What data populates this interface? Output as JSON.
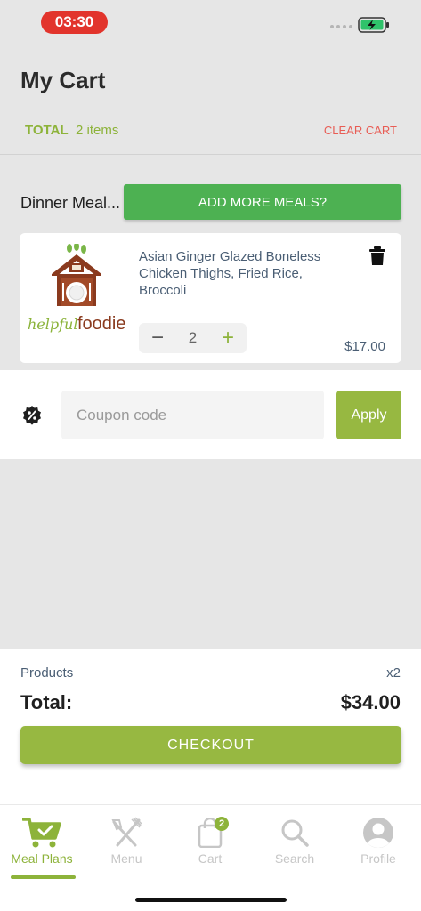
{
  "status_bar": {
    "time": "03:30",
    "colors": {
      "time_pill": "#e2342c",
      "battery": "#2fc36a"
    }
  },
  "header": {
    "title": "My Cart",
    "total_label": "TOTAL",
    "items_count": "2 items",
    "clear_cart_label": "CLEAR CART"
  },
  "plan": {
    "name": "Dinner Meal...",
    "add_more_label": "ADD MORE MEALS?"
  },
  "cart_item": {
    "brand": "helpfulfoodie",
    "name": "Asian Ginger Glazed Boneless Chicken Thighs, Fried Rice, Broccoli",
    "quantity": "2",
    "price": "$17.00"
  },
  "coupon": {
    "placeholder": "Coupon code",
    "value": "",
    "apply_label": "Apply"
  },
  "checkout": {
    "products_label": "Products",
    "products_count": "x2",
    "total_label": "Total:",
    "total_amount": "$34.00",
    "checkout_label": "CHECKOUT"
  },
  "tabs": [
    {
      "label": "Meal Plans",
      "icon": "cart-check-icon",
      "active": true
    },
    {
      "label": "Menu",
      "icon": "fork-knife-icon",
      "active": false
    },
    {
      "label": "Cart",
      "icon": "shopping-bag-icon",
      "active": false,
      "badge": "2"
    },
    {
      "label": "Search",
      "icon": "search-icon",
      "active": false
    },
    {
      "label": "Profile",
      "icon": "profile-icon",
      "active": false
    }
  ],
  "colors": {
    "accent": "#97b841",
    "accent_text": "#8db33a",
    "add_more": "#4db152",
    "clear_cart": "#e85d55"
  }
}
